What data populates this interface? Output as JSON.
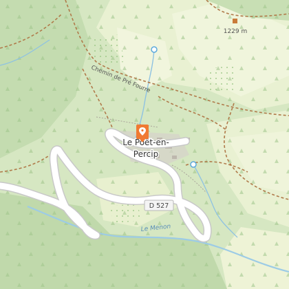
{
  "map": {
    "place_name_line1": "Le Poët-en-",
    "place_name_line2": "Percip",
    "road_label": "D 527",
    "track_label": "Chemin de Pré Fourre",
    "river_label": "Le Menon",
    "peak_label": "1229 m"
  },
  "colors": {
    "forest": "#c4dcb0",
    "forest_dark": "#b4d2a0",
    "meadow": "#e6efcc",
    "field": "#eef3d6",
    "water": "#b2d4ea",
    "water_stroke": "#8ec2e2",
    "road_fill": "#ffffff",
    "road_casing": "#c8c8c8",
    "track": "#b07a4a",
    "marker": "#f07a32",
    "built": "#d4d0c8"
  },
  "icons": [
    "location-marker-icon",
    "peak-icon",
    "spring-icon"
  ]
}
